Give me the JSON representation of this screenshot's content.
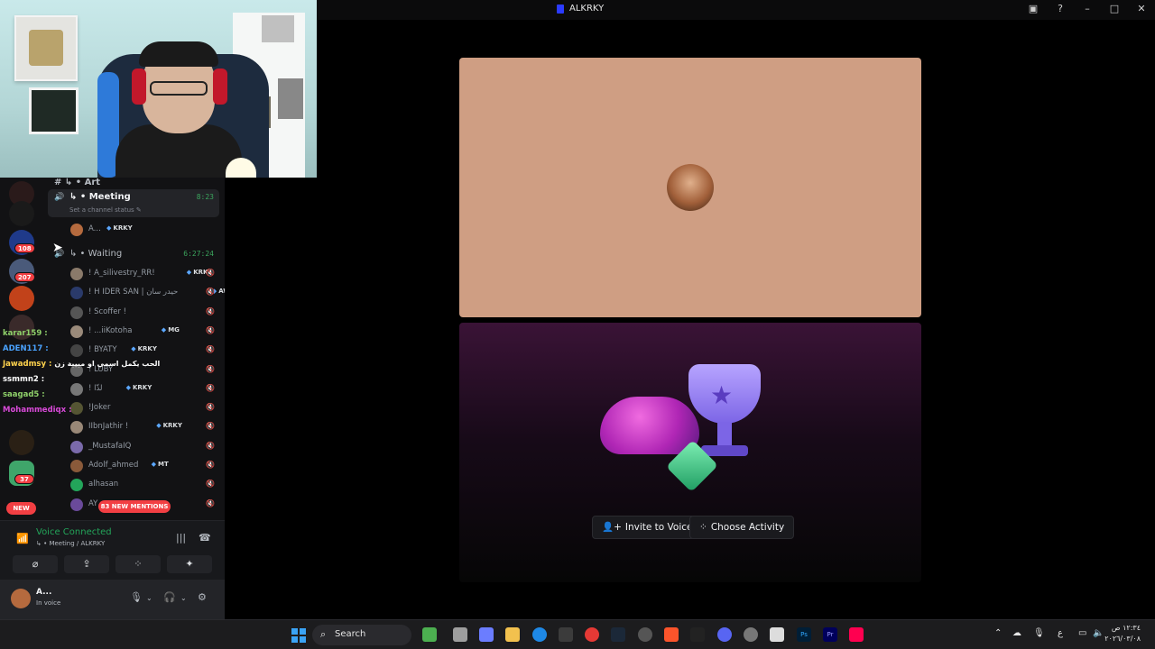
{
  "window": {
    "title": "ALKRKY"
  },
  "channels": {
    "art_label": "Art",
    "meeting": {
      "name": "Meeting",
      "timer": "8:23",
      "status": "Set a channel status"
    },
    "meeting_member": {
      "name": "A...",
      "tag": "KRKY"
    },
    "waiting": {
      "name": "Waiting",
      "timer": "6:27:24"
    },
    "members": [
      {
        "name": "! A_silivestry_RR!",
        "tag": "KRKY"
      },
      {
        "name": "! H IDER SAN | حيدر سان",
        "tag": "AW"
      },
      {
        "name": "! Scoffer !",
        "tag": ""
      },
      {
        "name": "! ...iiKotoha",
        "tag": "MG"
      },
      {
        "name": "! BYATY",
        "tag": "KRKY"
      },
      {
        "name": "! LUBY",
        "tag": ""
      },
      {
        "name": "! لذّا",
        "tag": "KRKY"
      },
      {
        "name": "!Joker",
        "tag": ""
      },
      {
        "name": "IIbnJathir !",
        "tag": "KRKY"
      },
      {
        "name": "_MustafaIQ",
        "tag": ""
      },
      {
        "name": "Adolf_ahmed",
        "tag": "MT"
      },
      {
        "name": "alhasan",
        "tag": ""
      },
      {
        "name": "AY",
        "tag": ""
      }
    ],
    "new_mentions": "83 NEW MENTIONS"
  },
  "rail": {
    "badges": [
      "108",
      "207",
      "37"
    ],
    "new_label": "NEW"
  },
  "chat": [
    {
      "user": "karar159 :",
      "msg": "",
      "color": "#8fd16a"
    },
    {
      "user": "ADEN117 :",
      "msg": "",
      "color": "#4aa3ff"
    },
    {
      "user": "Jawadmsy :",
      "msg": "الحب يكمل اسمي او مبيبة زن",
      "color": "#ffd34d"
    },
    {
      "user": "ssmmn2 :",
      "msg": "",
      "color": "#ffffff"
    },
    {
      "user": "saagad5 :",
      "msg": "",
      "color": "#8fd16a"
    },
    {
      "user": "Mohammediqx :",
      "msg": "",
      "color": "#d94ad9"
    }
  ],
  "voice": {
    "status": "Voice Connected",
    "location": "Meeting / ALKRKY"
  },
  "user": {
    "name": "A...",
    "status": "In voice"
  },
  "activity": {
    "invite_label": "Invite to Voice",
    "choose_label": "Choose Activity"
  },
  "taskbar": {
    "search_label": "Search",
    "clock_time": "١٢:٣٤ ص",
    "clock_date": "٢٠٢٦/٠٣/٠٨",
    "lang": "ع"
  }
}
